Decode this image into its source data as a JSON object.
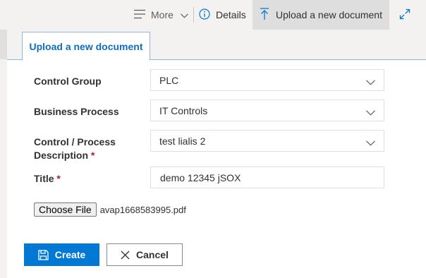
{
  "commandbar": {
    "more_label": "More",
    "details_label": "Details",
    "upload_label": "Upload a new document"
  },
  "tab": {
    "label": "Upload a new document"
  },
  "form": {
    "control_group": {
      "label": "Control Group",
      "value": "PLC"
    },
    "business_process": {
      "label": "Business Process",
      "value": "IT Controls"
    },
    "control_description": {
      "label_line1": "Control / Process",
      "label_line2": "Description",
      "required_mark": "*",
      "value": "test lialis 2"
    },
    "title": {
      "label": "Title",
      "required_mark": "*",
      "value": "demo 12345 jSOX"
    },
    "file": {
      "button_label": "Choose File",
      "file_name": "avap1668583995.pdf"
    }
  },
  "actions": {
    "create_label": "Create",
    "cancel_label": "Cancel"
  },
  "colors": {
    "accent": "#0078d4",
    "tab_text": "#106ebe",
    "required": "#a4262c"
  }
}
